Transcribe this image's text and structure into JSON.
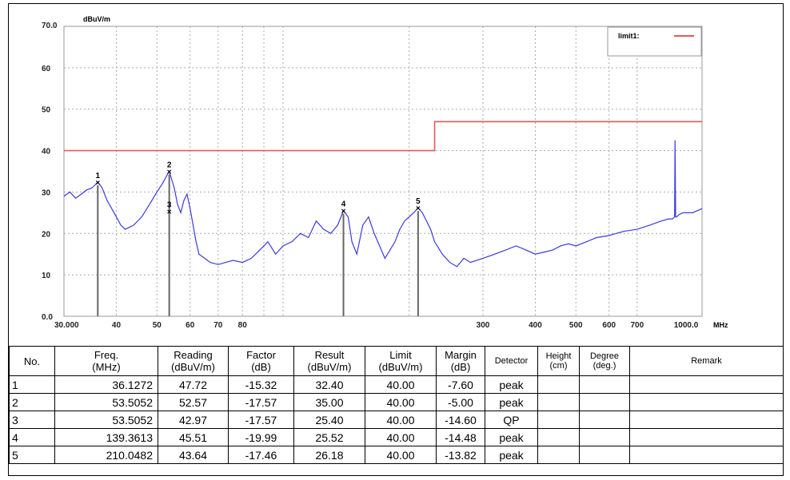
{
  "chart_data": {
    "type": "line",
    "ylabel": "dBuV/m",
    "xunit": "MHz",
    "xscale": "log",
    "xlim": [
      30,
      1000
    ],
    "ylim": [
      0,
      70
    ],
    "yticks": [
      0,
      10,
      20,
      30,
      40,
      50,
      60,
      70
    ],
    "ytick_labels": [
      "0.0",
      "10",
      "20",
      "30",
      "40",
      "50",
      "60",
      "70.0"
    ],
    "xticks": [
      30,
      40,
      50,
      60,
      70,
      80,
      300,
      400,
      500,
      600,
      700,
      1000
    ],
    "xtick_labels": [
      "30.000",
      "40",
      "50",
      "60",
      "70",
      "80",
      "300",
      "400",
      "500",
      "600",
      "700",
      "1000.0"
    ],
    "grid": true,
    "legend": {
      "position": "top-right",
      "entries": [
        {
          "label": "limit1:",
          "color": "#e8565b"
        }
      ]
    },
    "limit_line": [
      {
        "x": 30,
        "y": 40
      },
      {
        "x": 230,
        "y": 40
      },
      {
        "x": 230,
        "y": 47
      },
      {
        "x": 1000,
        "y": 47
      }
    ],
    "series": [
      {
        "color": "#3a3ae0",
        "x": [
          30,
          31,
          32,
          33,
          34,
          35,
          36.13,
          37,
          38,
          39,
          40,
          41,
          42,
          44,
          46,
          48,
          50,
          51.5,
          53.5,
          55,
          56,
          57,
          58,
          59,
          60,
          61,
          62,
          63,
          65,
          67,
          70,
          73,
          76,
          80,
          84,
          88,
          92,
          96,
          100,
          105,
          110,
          115,
          120,
          125,
          130,
          135,
          139.36,
          143,
          146,
          150,
          155,
          160,
          165,
          170,
          175,
          180,
          185,
          190,
          195,
          200,
          205,
          210.05,
          215,
          220,
          225,
          230,
          240,
          250,
          260,
          270,
          280,
          300,
          320,
          340,
          360,
          380,
          400,
          420,
          440,
          460,
          480,
          500,
          530,
          560,
          600,
          650,
          700,
          750,
          800,
          830,
          850,
          860,
          862,
          865,
          870,
          880,
          900,
          950,
          1000
        ],
        "y": [
          29,
          30,
          28.5,
          29.5,
          30.5,
          31,
          32.4,
          31,
          28,
          26,
          24,
          22,
          21,
          22,
          24,
          27,
          30,
          32,
          35,
          31,
          27,
          25,
          28,
          29.5,
          26,
          22,
          18,
          15,
          14,
          13,
          12.5,
          13,
          13.5,
          13,
          14,
          16,
          18,
          15,
          17,
          18,
          20,
          19,
          23,
          21,
          20,
          22,
          25.5,
          24,
          18,
          15,
          22,
          24,
          20,
          17,
          14,
          16,
          18,
          21,
          23,
          24,
          25,
          26.2,
          25,
          23,
          21,
          18,
          15,
          13,
          12,
          14,
          13,
          14,
          15,
          16,
          17,
          16,
          15,
          15.5,
          16,
          17,
          17.5,
          17,
          18,
          19,
          19.5,
          20.5,
          21,
          22,
          23,
          23.5,
          23.5,
          24,
          42.5,
          24,
          24,
          24.5,
          25,
          25,
          26
        ]
      }
    ],
    "markers": [
      {
        "label": "1",
        "x": 36.1272,
        "y": 32.4,
        "line": true
      },
      {
        "label": "2",
        "x": 53.5052,
        "y": 35.0,
        "line": true
      },
      {
        "label": "3",
        "x": 53.5052,
        "y": 25.4,
        "line": false
      },
      {
        "label": "4",
        "x": 139.3613,
        "y": 25.52,
        "line": true
      },
      {
        "label": "5",
        "x": 210.0482,
        "y": 26.18,
        "line": true
      }
    ]
  },
  "table": {
    "headers": {
      "no": "No.",
      "freq": [
        "Freq.",
        "(MHz)"
      ],
      "reading": [
        "Reading",
        "(dBuV/m)"
      ],
      "factor": [
        "Factor",
        "(dB)"
      ],
      "result": [
        "Result",
        "(dBuV/m)"
      ],
      "limit": [
        "Limit",
        "(dBuV/m)"
      ],
      "margin": [
        "Margin",
        "(dB)"
      ],
      "detector": "Detector",
      "height": [
        "Height",
        "(cm)"
      ],
      "degree": [
        "Degree",
        "(deg.)"
      ],
      "remark": "Remark"
    },
    "rows": [
      {
        "no": "1",
        "freq": "36.1272",
        "reading": "47.72",
        "factor": "-15.32",
        "result": "32.40",
        "limit": "40.00",
        "margin": "-7.60",
        "detector": "peak",
        "height": "",
        "degree": "",
        "remark": ""
      },
      {
        "no": "2",
        "freq": "53.5052",
        "reading": "52.57",
        "factor": "-17.57",
        "result": "35.00",
        "limit": "40.00",
        "margin": "-5.00",
        "detector": "peak",
        "height": "",
        "degree": "",
        "remark": ""
      },
      {
        "no": "3",
        "freq": "53.5052",
        "reading": "42.97",
        "factor": "-17.57",
        "result": "25.40",
        "limit": "40.00",
        "margin": "-14.60",
        "detector": "QP",
        "height": "",
        "degree": "",
        "remark": ""
      },
      {
        "no": "4",
        "freq": "139.3613",
        "reading": "45.51",
        "factor": "-19.99",
        "result": "25.52",
        "limit": "40.00",
        "margin": "-14.48",
        "detector": "peak",
        "height": "",
        "degree": "",
        "remark": ""
      },
      {
        "no": "5",
        "freq": "210.0482",
        "reading": "43.64",
        "factor": "-17.46",
        "result": "26.18",
        "limit": "40.00",
        "margin": "-13.82",
        "detector": "peak",
        "height": "",
        "degree": "",
        "remark": ""
      }
    ]
  }
}
